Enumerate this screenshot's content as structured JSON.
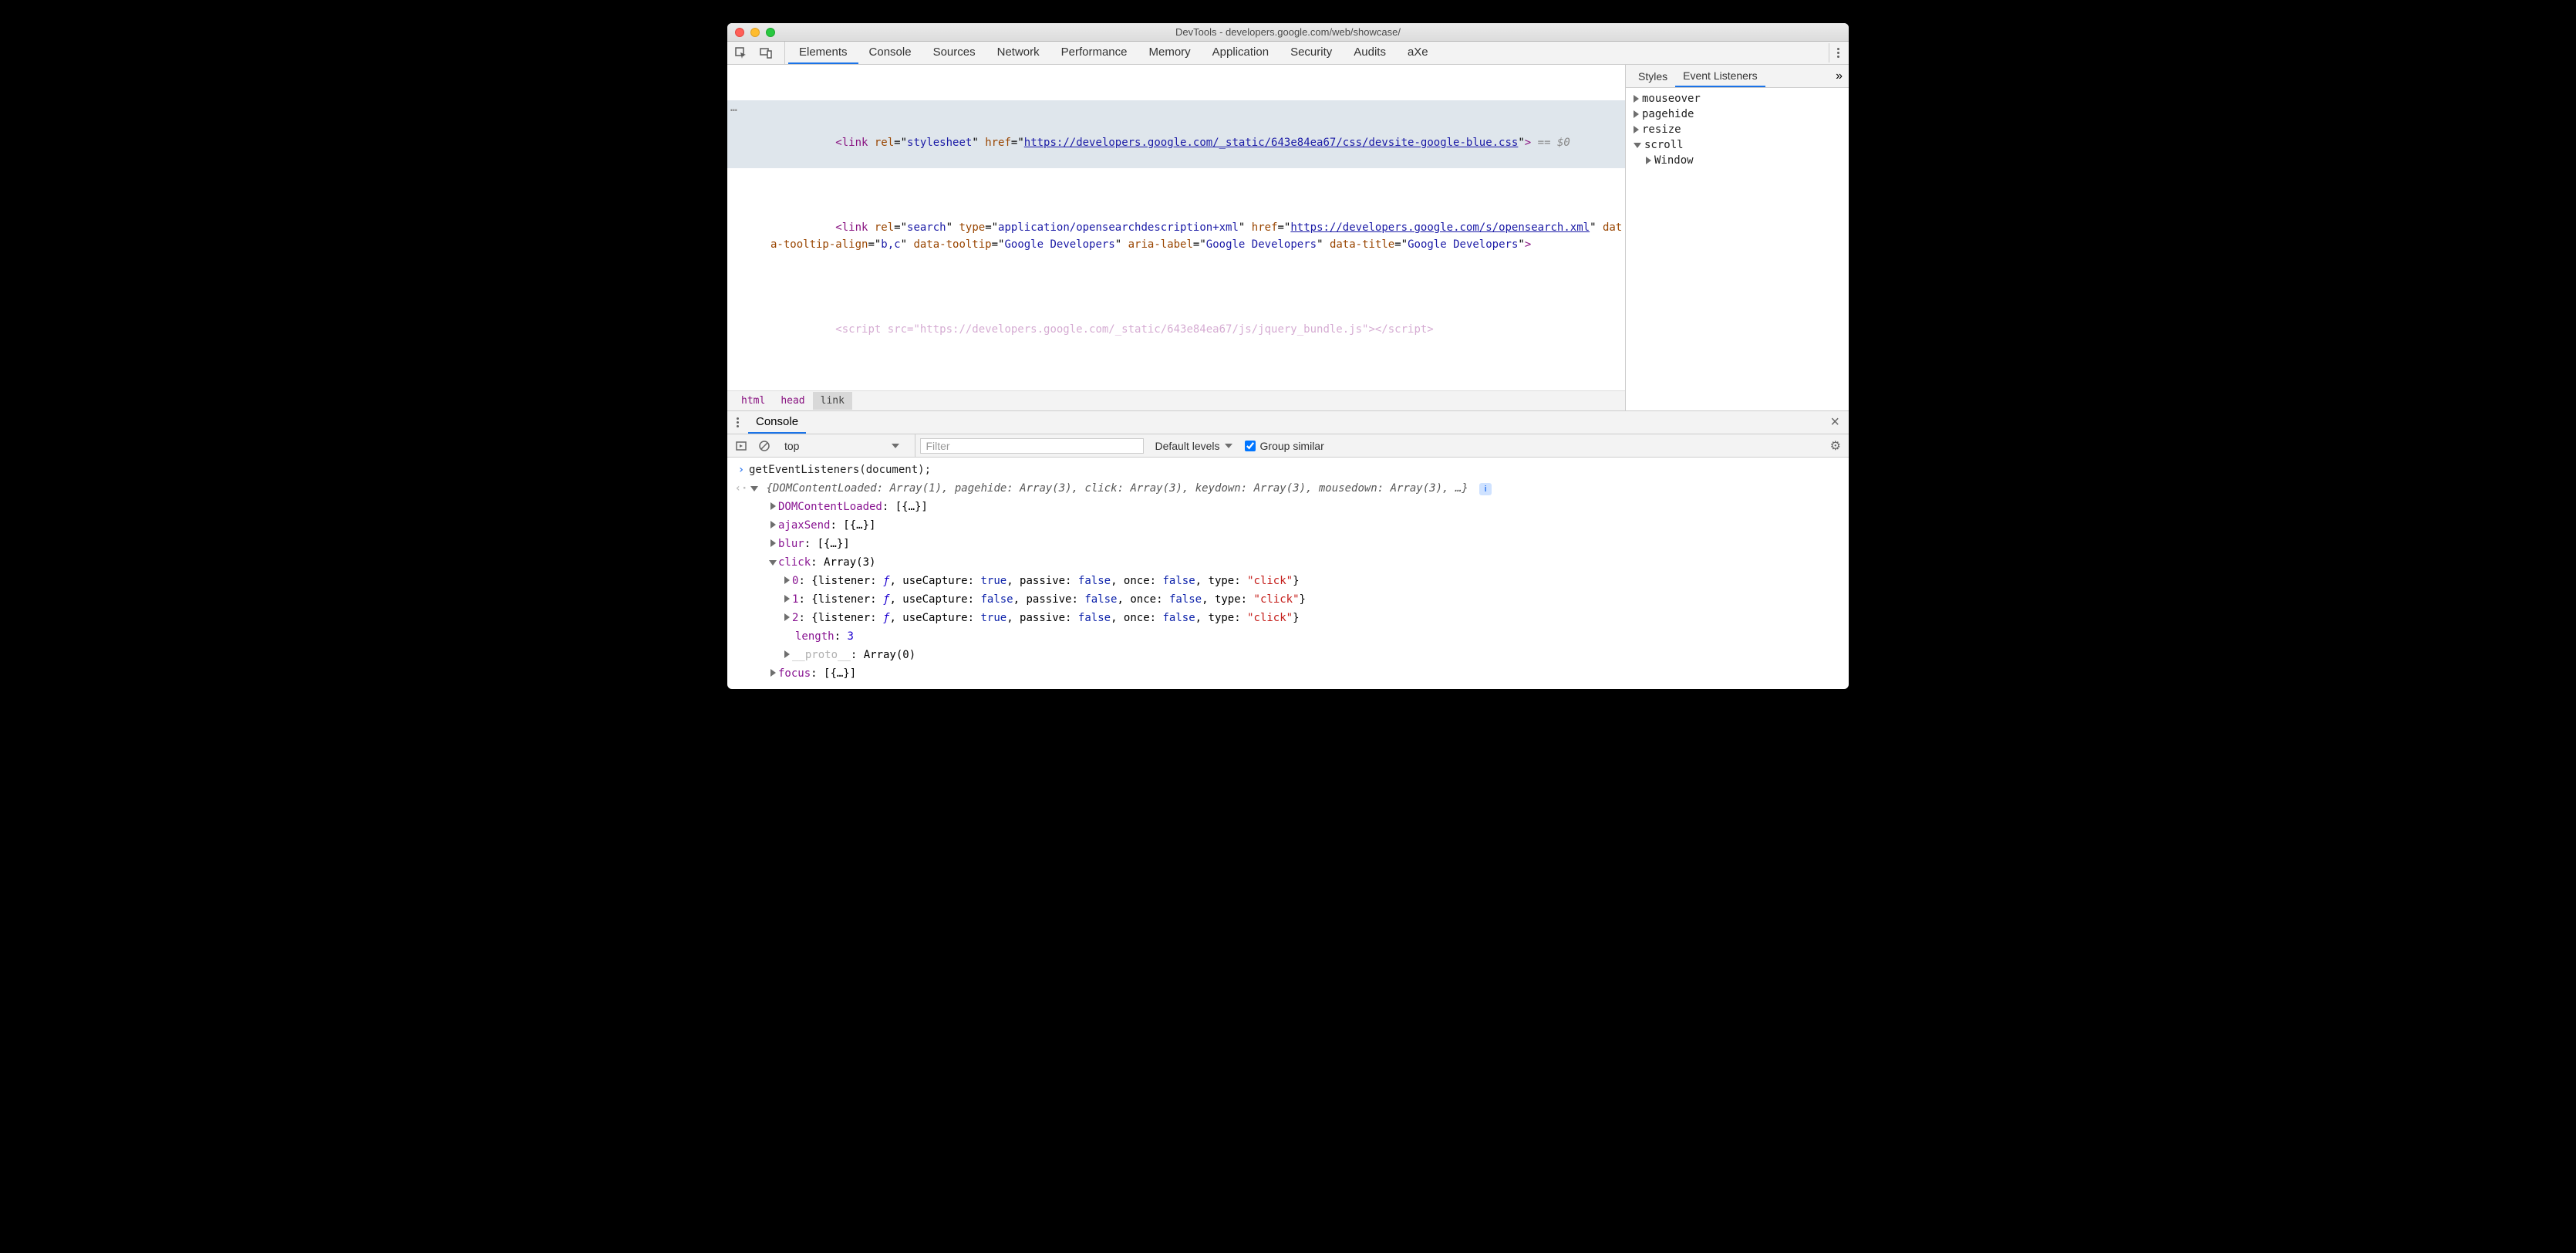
{
  "window_title": "DevTools - developers.google.com/web/showcase/",
  "main_tabs": [
    "Elements",
    "Console",
    "Sources",
    "Network",
    "Performance",
    "Memory",
    "Application",
    "Security",
    "Audits",
    "aXe"
  ],
  "main_tab_active": "Elements",
  "dom": {
    "sel_link": {
      "rel": "stylesheet",
      "href_text": "https://developers.google.com/_static/643e84ea67/css/devsite-google-blue.css",
      "suffix": " == $0"
    },
    "link2": {
      "rel": "search",
      "type": "application/opensearchdescription+xml",
      "href_text": "https://developers.google.com/s/opensearch.xml",
      "tooltip_align": "b,c",
      "tooltip": "Google Developers",
      "aria_label": "Google Developers",
      "data_title": "Google Developers"
    },
    "script_cut": "<script src=\"https://developers.google.com/_static/643e84ea67/js/jquery_bundle.js\"></script>"
  },
  "breadcrumb": [
    "html",
    "head",
    "link"
  ],
  "breadcrumb_current": "link",
  "side_tabs": [
    "Styles",
    "Event Listeners"
  ],
  "side_tab_active": "Event Listeners",
  "listeners": [
    {
      "name": "mouseover",
      "expanded": false
    },
    {
      "name": "pagehide",
      "expanded": false
    },
    {
      "name": "resize",
      "expanded": false
    },
    {
      "name": "scroll",
      "expanded": true,
      "children": [
        "Window"
      ]
    }
  ],
  "drawer_tab": "Console",
  "console_bar": {
    "context": "top",
    "filter_placeholder": "Filter",
    "levels_label": "Default levels",
    "group_similar": "Group similar"
  },
  "console": {
    "input": "getEventListeners(document);",
    "summary": "{DOMContentLoaded: Array(1), pagehide: Array(3), click: Array(3), keydown: Array(3), mousedown: Array(3), …}",
    "rows": [
      {
        "k": "DOMContentLoaded",
        "v": "[{…}]"
      },
      {
        "k": "ajaxSend",
        "v": "[{…}]"
      },
      {
        "k": "blur",
        "v": "[{…}]"
      }
    ],
    "click_header": "click: Array(3)",
    "click_items": [
      {
        "idx": "0",
        "useCapture": "true",
        "passive": "false",
        "once": "false",
        "type": "\"click\""
      },
      {
        "idx": "1",
        "useCapture": "false",
        "passive": "false",
        "once": "false",
        "type": "\"click\""
      },
      {
        "idx": "2",
        "useCapture": "true",
        "passive": "false",
        "once": "false",
        "type": "\"click\""
      }
    ],
    "length_label": "length",
    "length_val": "3",
    "proto_label": "__proto__",
    "proto_val": "Array(0)",
    "focus": {
      "k": "focus",
      "v": "[{…}]"
    }
  }
}
